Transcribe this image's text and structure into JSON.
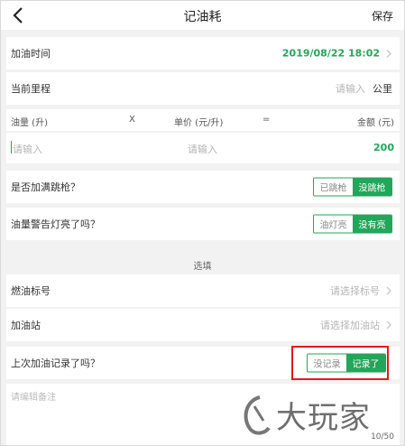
{
  "nav": {
    "title": "记油耗",
    "save_label": "保存",
    "back_icon": "chevron-left-icon"
  },
  "fuel_time": {
    "label": "加油时间",
    "value": "2019/08/22 18:02"
  },
  "mileage": {
    "label": "当前里程",
    "placeholder": "请输入",
    "unit": "公里"
  },
  "calc_header": {
    "qty": "油量 (升)",
    "times": "X",
    "price": "单价 (元/升)",
    "equals": "=",
    "amount": "金额 (元)"
  },
  "calc_inputs": {
    "qty_placeholder": "请输入",
    "price_placeholder": "请输入",
    "amount_value": "200"
  },
  "full_tank": {
    "label": "是否加满跳枪？",
    "option_off": "已跳枪",
    "option_on": "没跳枪"
  },
  "warning_light": {
    "label": "油量警告灯亮了吗？",
    "option_off": "油灯亮",
    "option_on": "没有亮"
  },
  "section_optional": "选填",
  "fuel_grade": {
    "label": "燃油标号",
    "placeholder": "请选择标号"
  },
  "station": {
    "label": "加油站",
    "placeholder": "请选择加油站"
  },
  "last_record": {
    "label": "上次加油记录了吗？",
    "option_off": "没记录",
    "option_on": "记录了"
  },
  "notes": {
    "placeholder": "请编辑备注",
    "counter": "10/50"
  },
  "watermark": {
    "text": "大玩家"
  },
  "colors": {
    "accent": "#22a65a",
    "highlight": "#e41a1a",
    "background": "#f2f2f2"
  }
}
